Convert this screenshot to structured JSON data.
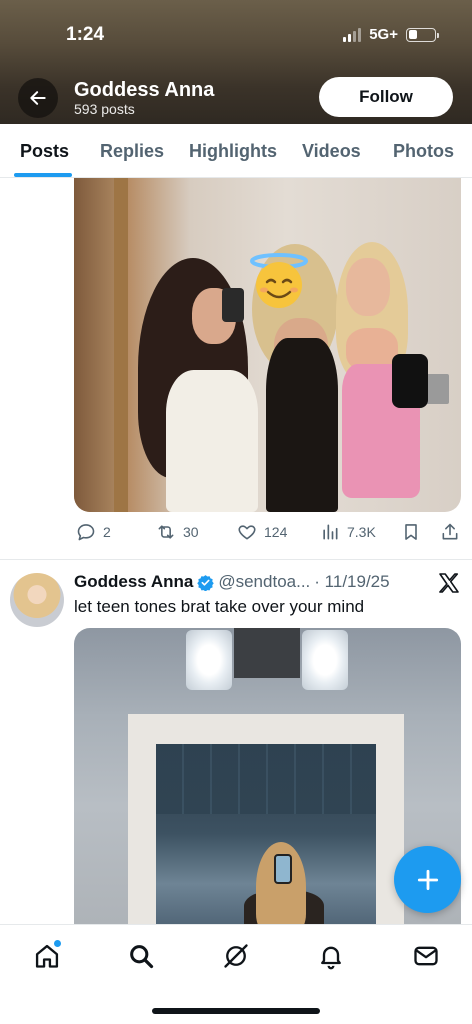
{
  "status_bar": {
    "time": "1:24",
    "network": "5G+"
  },
  "header": {
    "name": "Goddess Anna",
    "post_count": "593 posts",
    "follow_label": "Follow"
  },
  "tabs": [
    {
      "label": "Posts",
      "active": true
    },
    {
      "label": "Replies",
      "active": false
    },
    {
      "label": "Highlights",
      "active": false
    },
    {
      "label": "Videos",
      "active": false
    },
    {
      "label": "Photos",
      "active": false
    }
  ],
  "post1": {
    "replies": "2",
    "reposts": "30",
    "likes": "124",
    "views": "7.3K",
    "icons": [
      "reply-icon",
      "repost-icon",
      "like-icon",
      "views-icon",
      "bookmark-icon",
      "share-icon"
    ]
  },
  "post2": {
    "author": "Goddess Anna",
    "handle": "@sendtoa...",
    "date": "· 11/19/25",
    "text": "let teen tones brat take over your mind",
    "source_icon": "x-logo-icon"
  },
  "bottom_nav": [
    "home-icon",
    "search-icon",
    "grok-icon",
    "notifications-icon",
    "messages-icon"
  ],
  "colors": {
    "accent": "#1d9bf0",
    "text": "#0f1419",
    "muted": "#536471",
    "header_bg": "#4a4134"
  }
}
